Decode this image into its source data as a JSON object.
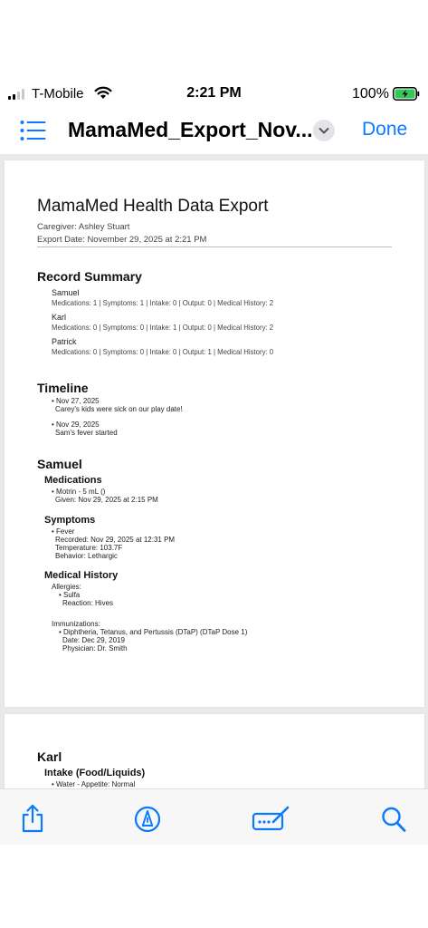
{
  "status_bar": {
    "carrier": "T-Mobile",
    "time": "2:21 PM",
    "battery": "100%"
  },
  "nav": {
    "title": "MamaMed_Export_Nov...",
    "done": "Done"
  },
  "document": {
    "title": "MamaMed Health Data Export",
    "caregiver": "Caregiver: Ashley Stuart",
    "export_date": "Export Date: November 29, 2025 at 2:21 PM",
    "record_summary": {
      "heading": "Record Summary",
      "people": [
        {
          "name": "Samuel",
          "counts": "Medications: 1 | Symptoms: 1 | Intake: 0 | Output: 0 | Medical History: 2"
        },
        {
          "name": "Karl",
          "counts": "Medications: 0 | Symptoms: 0 | Intake: 1 | Output: 0 | Medical History: 2"
        },
        {
          "name": "Patrick",
          "counts": "Medications: 0 | Symptoms: 0 | Intake: 0 | Output: 1 | Medical History: 0"
        }
      ]
    },
    "timeline": {
      "heading": "Timeline",
      "entries": [
        {
          "date": "• Nov 27, 2025",
          "note": "Carey's kids were sick on our play date!"
        },
        {
          "date": "• Nov 29, 2025",
          "note": "Sam's fever started"
        }
      ]
    },
    "samuel": {
      "heading": "Samuel",
      "medications": {
        "heading": "Medications",
        "item": "• Motrin - 5 mL ()",
        "given": "Given: Nov 29, 2025 at 2:15 PM"
      },
      "symptoms": {
        "heading": "Symptoms",
        "item": "• Fever",
        "recorded": "Recorded: Nov 29, 2025 at 12:31 PM",
        "temperature": "Temperature: 103.7F",
        "behavior": "Behavior: Lethargic"
      },
      "medical_history": {
        "heading": "Medical History",
        "allergies_label": "Allergies:",
        "allergy": "• Sulfa",
        "reaction": "Reaction: Hives",
        "immunizations_label": "Immunizations:",
        "immunization": "• Diphtheria, Tetanus, and Pertussis (DTaP) (DTaP Dose 1)",
        "imm_date": "Date: Dec 29, 2019",
        "physician": "Physician: Dr. Smith"
      }
    },
    "karl": {
      "heading": "Karl",
      "intake": {
        "heading": "Intake (Food/Liquids)",
        "item": "• Water - Appetite: Normal"
      }
    }
  },
  "colors": {
    "accent": "#0a7aff",
    "battery_green": "#34c759",
    "viewer_bg": "#e9e9ea"
  },
  "icons": {
    "list": "list-icon",
    "chevron": "chevron-down-icon",
    "share": "share-icon",
    "markup": "markup-pen-icon",
    "signature": "signature-icon",
    "search": "search-icon"
  }
}
